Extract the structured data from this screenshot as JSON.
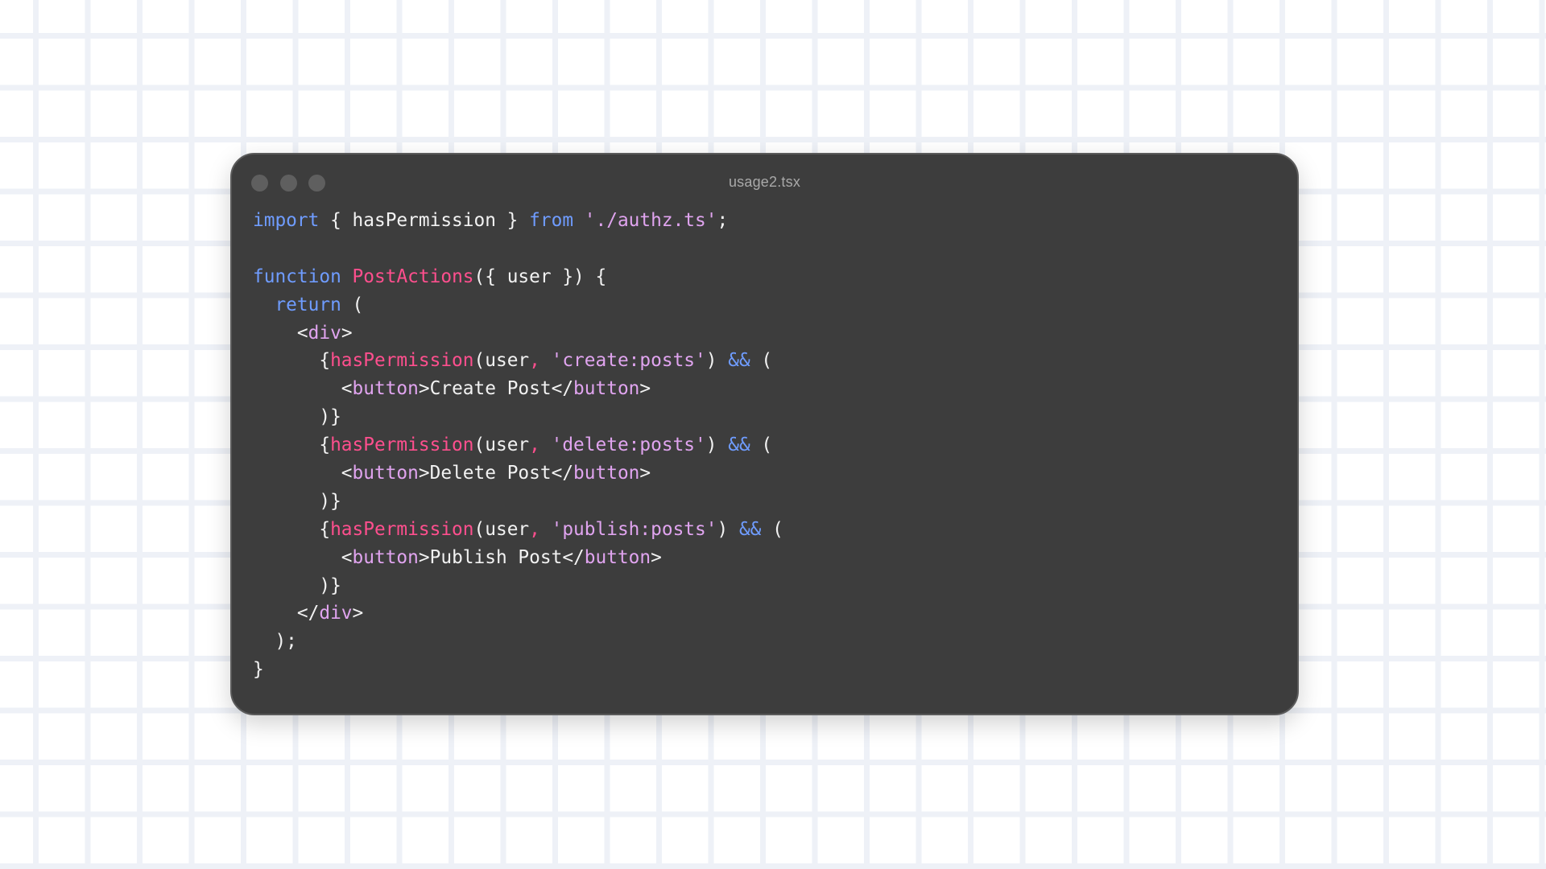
{
  "window": {
    "title": "usage2.tsx"
  },
  "colors": {
    "background": "#ffffff",
    "grid_line": "#eef1f7",
    "window_bg": "#3d3d3d",
    "dot": "#5f5f5f",
    "keyword": "#6f9cff",
    "string": "#e0a4ef",
    "function": "#ff4f8e",
    "plain": "#f2f2f2"
  },
  "code": {
    "lines": [
      [
        {
          "t": "import",
          "c": "keyword"
        },
        {
          "t": " { hasPermission } ",
          "c": "plain"
        },
        {
          "t": "from",
          "c": "keyword"
        },
        {
          "t": " ",
          "c": "plain"
        },
        {
          "t": "'./authz.ts'",
          "c": "string"
        },
        {
          "t": ";",
          "c": "plain"
        }
      ],
      [],
      [
        {
          "t": "function",
          "c": "keyword"
        },
        {
          "t": " ",
          "c": "plain"
        },
        {
          "t": "PostActions",
          "c": "func"
        },
        {
          "t": "({ user }) {",
          "c": "plain"
        }
      ],
      [
        {
          "t": "  ",
          "c": "plain"
        },
        {
          "t": "return",
          "c": "keyword"
        },
        {
          "t": " (",
          "c": "plain"
        }
      ],
      [
        {
          "t": "    <",
          "c": "plain"
        },
        {
          "t": "div",
          "c": "tag"
        },
        {
          "t": ">",
          "c": "plain"
        }
      ],
      [
        {
          "t": "      {",
          "c": "plain"
        },
        {
          "t": "hasPermission",
          "c": "func"
        },
        {
          "t": "(user",
          "c": "plain"
        },
        {
          "t": ",",
          "c": "comma"
        },
        {
          "t": " ",
          "c": "plain"
        },
        {
          "t": "'create:posts'",
          "c": "string"
        },
        {
          "t": ") ",
          "c": "plain"
        },
        {
          "t": "&&",
          "c": "op"
        },
        {
          "t": " (",
          "c": "plain"
        }
      ],
      [
        {
          "t": "        <",
          "c": "plain"
        },
        {
          "t": "button",
          "c": "tag"
        },
        {
          "t": ">Create Post</",
          "c": "plain"
        },
        {
          "t": "button",
          "c": "tag"
        },
        {
          "t": ">",
          "c": "plain"
        }
      ],
      [
        {
          "t": "      )}",
          "c": "plain"
        }
      ],
      [
        {
          "t": "      {",
          "c": "plain"
        },
        {
          "t": "hasPermission",
          "c": "func"
        },
        {
          "t": "(user",
          "c": "plain"
        },
        {
          "t": ",",
          "c": "comma"
        },
        {
          "t": " ",
          "c": "plain"
        },
        {
          "t": "'delete:posts'",
          "c": "string"
        },
        {
          "t": ") ",
          "c": "plain"
        },
        {
          "t": "&&",
          "c": "op"
        },
        {
          "t": " (",
          "c": "plain"
        }
      ],
      [
        {
          "t": "        <",
          "c": "plain"
        },
        {
          "t": "button",
          "c": "tag"
        },
        {
          "t": ">Delete Post</",
          "c": "plain"
        },
        {
          "t": "button",
          "c": "tag"
        },
        {
          "t": ">",
          "c": "plain"
        }
      ],
      [
        {
          "t": "      )}",
          "c": "plain"
        }
      ],
      [
        {
          "t": "      {",
          "c": "plain"
        },
        {
          "t": "hasPermission",
          "c": "func"
        },
        {
          "t": "(user",
          "c": "plain"
        },
        {
          "t": ",",
          "c": "comma"
        },
        {
          "t": " ",
          "c": "plain"
        },
        {
          "t": "'publish:posts'",
          "c": "string"
        },
        {
          "t": ") ",
          "c": "plain"
        },
        {
          "t": "&&",
          "c": "op"
        },
        {
          "t": " (",
          "c": "plain"
        }
      ],
      [
        {
          "t": "        <",
          "c": "plain"
        },
        {
          "t": "button",
          "c": "tag"
        },
        {
          "t": ">Publish Post</",
          "c": "plain"
        },
        {
          "t": "button",
          "c": "tag"
        },
        {
          "t": ">",
          "c": "plain"
        }
      ],
      [
        {
          "t": "      )}",
          "c": "plain"
        }
      ],
      [
        {
          "t": "    </",
          "c": "plain"
        },
        {
          "t": "div",
          "c": "tag"
        },
        {
          "t": ">",
          "c": "plain"
        }
      ],
      [
        {
          "t": "  );",
          "c": "plain"
        }
      ],
      [
        {
          "t": "}",
          "c": "plain"
        }
      ]
    ]
  }
}
